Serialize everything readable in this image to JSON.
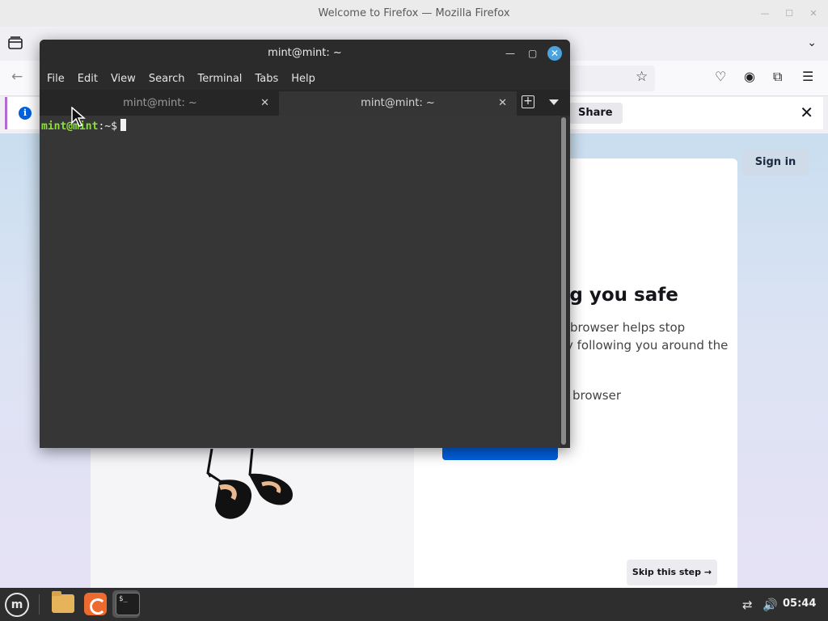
{
  "firefox": {
    "window_title": "Welcome to Firefox — Mozilla Firefox",
    "notification_share": "Share",
    "notification_close": "✕",
    "sign_in": "Sign in",
    "heading_partial": "ng you safe",
    "body_line1": "browser helps stop",
    "body_line2": "y following you around the",
    "body_line3": "browser",
    "skip_button": "Skip this step →"
  },
  "terminal": {
    "title": "mint@mint: ~",
    "menu": [
      "File",
      "Edit",
      "View",
      "Search",
      "Terminal",
      "Tabs",
      "Help"
    ],
    "tabs": [
      {
        "label": "mint@mint: ~",
        "active": false
      },
      {
        "label": "mint@mint: ~",
        "active": true
      }
    ],
    "prompt_user": "mint@mint",
    "prompt_path": ":~$"
  },
  "taskbar": {
    "clock": "05:44"
  }
}
